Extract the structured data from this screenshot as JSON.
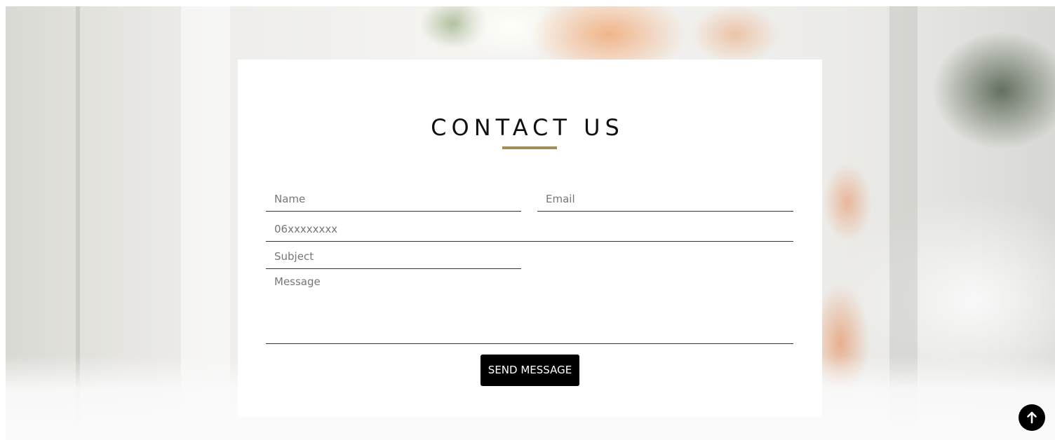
{
  "contact": {
    "title": "CONTACT US",
    "fields": {
      "name_placeholder": "Name",
      "email_placeholder": "Email",
      "phone_placeholder": "06xxxxxxxx",
      "subject_placeholder": "Subject",
      "message_placeholder": "Message"
    },
    "send_label": "SEND MESSAGE"
  },
  "icons": {
    "back_to_top": "arrow-up-icon"
  },
  "colors": {
    "accent": "#a88d52",
    "button": "#000000",
    "button_text": "#ffffff",
    "card": "#ffffff"
  }
}
